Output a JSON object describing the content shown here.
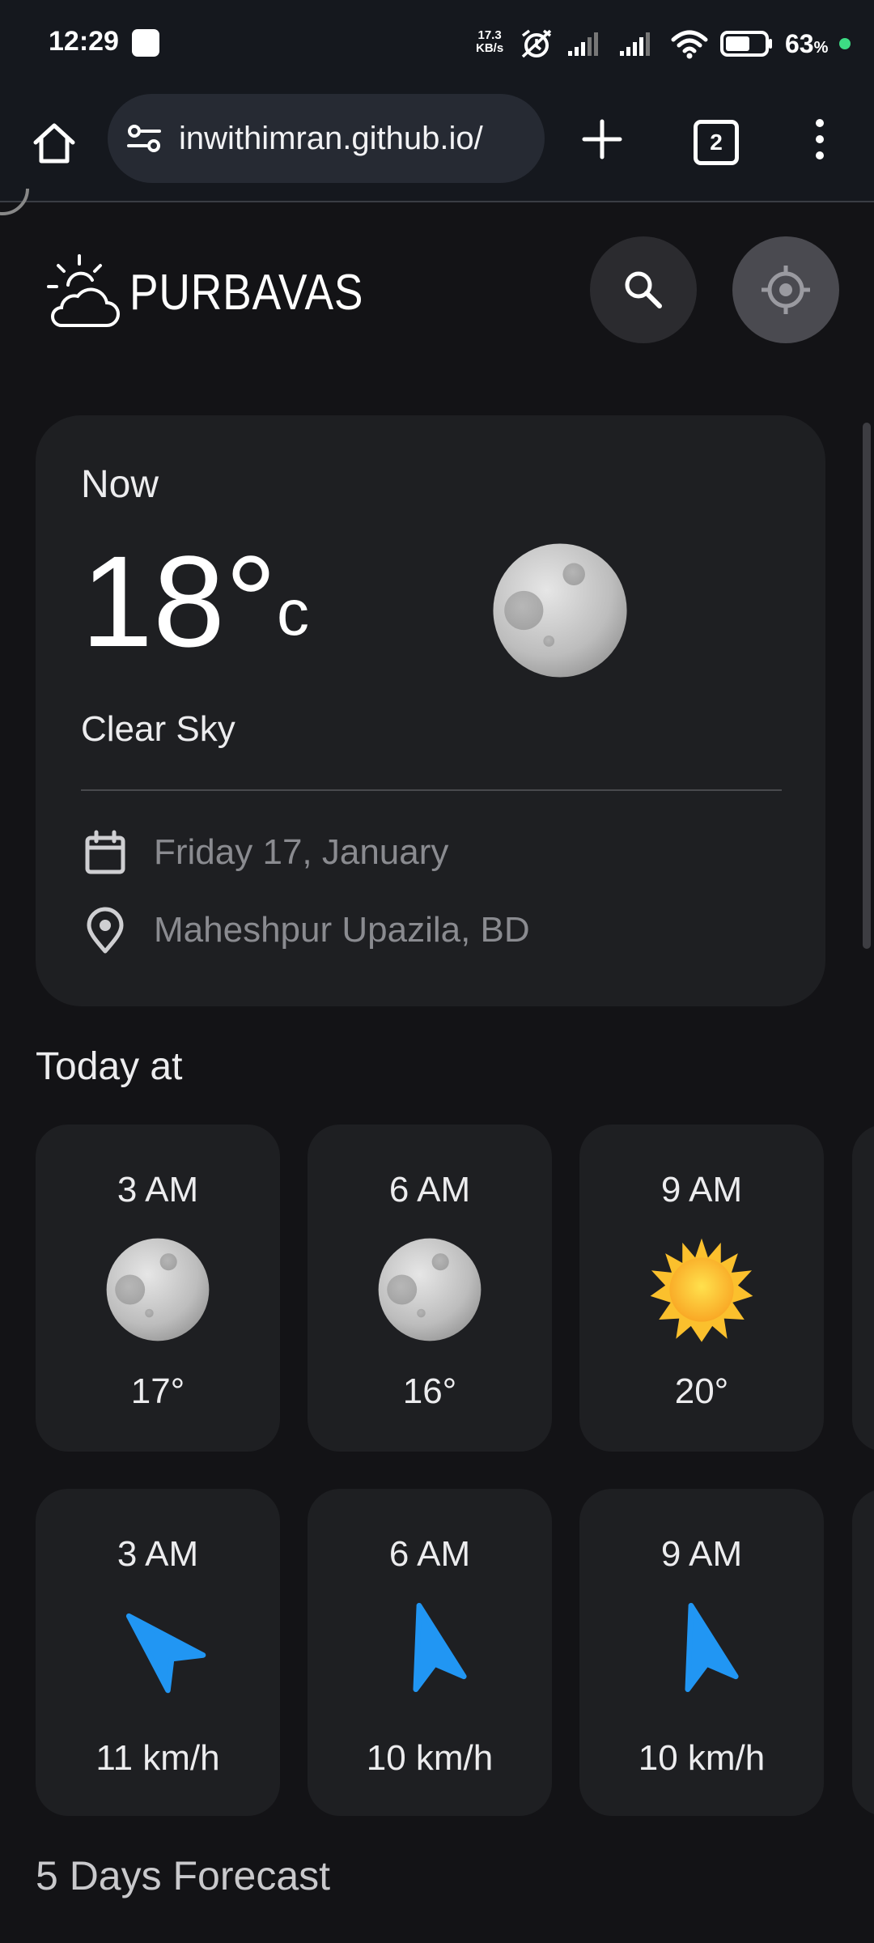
{
  "status_bar": {
    "time": "12:29",
    "net_speed": "17.3",
    "net_unit": "KB/s",
    "battery_percent": "63",
    "battery_suffix": "%",
    "battery_level": 0.63
  },
  "browser": {
    "url": "inwithimran.github.io/",
    "tab_count": "2"
  },
  "app": {
    "brand": "PURBAVAS"
  },
  "now": {
    "label": "Now",
    "temp": "18°",
    "unit": "c",
    "description": "Clear Sky",
    "date": "Friday 17, January",
    "location": "Maheshpur Upazila, BD",
    "icon": "moon-icon"
  },
  "today": {
    "title": "Today at",
    "temps": [
      {
        "time": "3 AM",
        "icon": "moon-icon",
        "value": "17°"
      },
      {
        "time": "6 AM",
        "icon": "moon-icon",
        "value": "16°"
      },
      {
        "time": "9 AM",
        "icon": "sun-icon",
        "value": "20°"
      }
    ],
    "winds": [
      {
        "time": "3 AM",
        "icon": "wind-direction-icon",
        "value": "11 km/h"
      },
      {
        "time": "6 AM",
        "icon": "wind-direction-icon",
        "value": "10 km/h"
      },
      {
        "time": "9 AM",
        "icon": "wind-direction-icon",
        "value": "10 km/h"
      }
    ]
  },
  "forecast": {
    "title": "5 Days Forecast"
  },
  "colors": {
    "background": "#131316",
    "card": "#1e1f22",
    "accent_wind": "#2196f3",
    "sun": "#fbc02d"
  }
}
